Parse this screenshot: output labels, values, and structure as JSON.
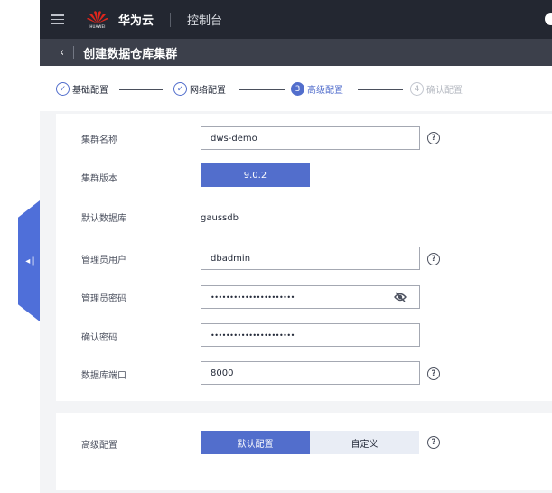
{
  "side_handle": {
    "glyph": "◂❙",
    "icon": "collapse-left-icon"
  },
  "topbar": {
    "menu_icon": "hamburger-menu-icon",
    "logo_text": "HUAWEI",
    "brand": "华为云",
    "console_label": "控制台"
  },
  "subbar": {
    "back_glyph": "‹",
    "title": "创建数据仓库集群"
  },
  "steps": [
    {
      "label": "基础配置",
      "marker": "✓",
      "state": "done"
    },
    {
      "label": "网络配置",
      "marker": "✓",
      "state": "done"
    },
    {
      "label": "高级配置",
      "marker": "3",
      "state": "current"
    },
    {
      "label": "确认配置",
      "marker": "4",
      "state": "todo"
    }
  ],
  "form": {
    "cluster_name": {
      "label": "集群名称",
      "value": "dws-demo"
    },
    "cluster_version": {
      "label": "集群版本",
      "value": "9.0.2"
    },
    "default_db": {
      "label": "默认数据库",
      "value": "gaussdb"
    },
    "admin_user": {
      "label": "管理员用户",
      "value": "dbadmin"
    },
    "admin_password": {
      "label": "管理员密码",
      "value": "••••••••••••••••••••••"
    },
    "confirm_password": {
      "label": "确认密码",
      "value": "••••••••••••••••••••••"
    },
    "db_port": {
      "label": "数据库端口",
      "value": "8000"
    },
    "help_glyph": "?"
  },
  "advanced": {
    "label": "高级配置",
    "options": [
      "默认配置",
      "自定义"
    ],
    "selected": "默认配置"
  },
  "colors": {
    "accent": "#526ecc",
    "header_bg": "#232731",
    "subheader_bg": "#3c404b"
  }
}
